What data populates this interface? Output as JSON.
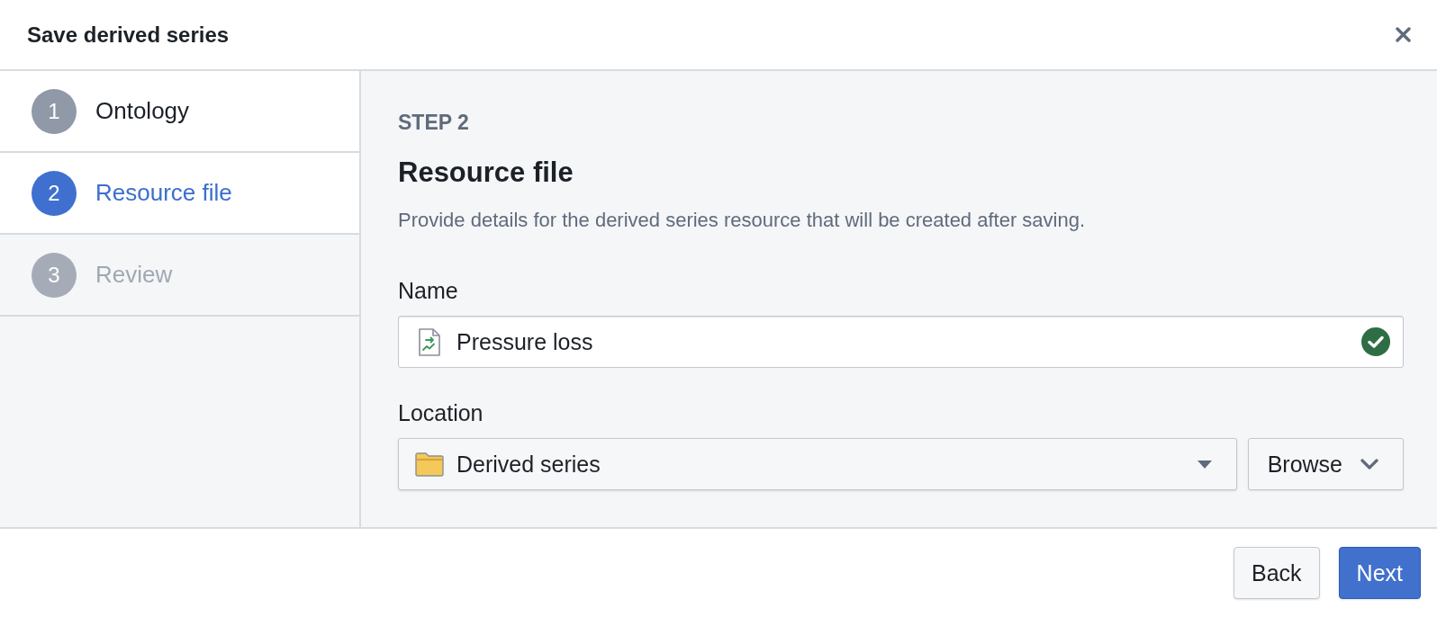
{
  "dialog": {
    "title": "Save derived series"
  },
  "steps": [
    {
      "number": "1",
      "label": "Ontology",
      "selected": false,
      "disabled": false
    },
    {
      "number": "2",
      "label": "Resource file",
      "selected": true,
      "disabled": false
    },
    {
      "number": "3",
      "label": "Review",
      "selected": false,
      "disabled": true
    }
  ],
  "panel": {
    "step_label": "STEP 2",
    "heading": "Resource file",
    "description": "Provide details for the derived series resource that will be created after saving."
  },
  "fields": [
    {
      "kind": "text",
      "label": "Name",
      "value": "Pressure loss",
      "valid": true
    },
    {
      "kind": "select",
      "label": "Location",
      "value": "Derived series",
      "button": "Browse"
    }
  ],
  "buttons": [
    {
      "kind": "secondary",
      "label": "Back"
    },
    {
      "kind": "primary",
      "label": "Next"
    }
  ]
}
